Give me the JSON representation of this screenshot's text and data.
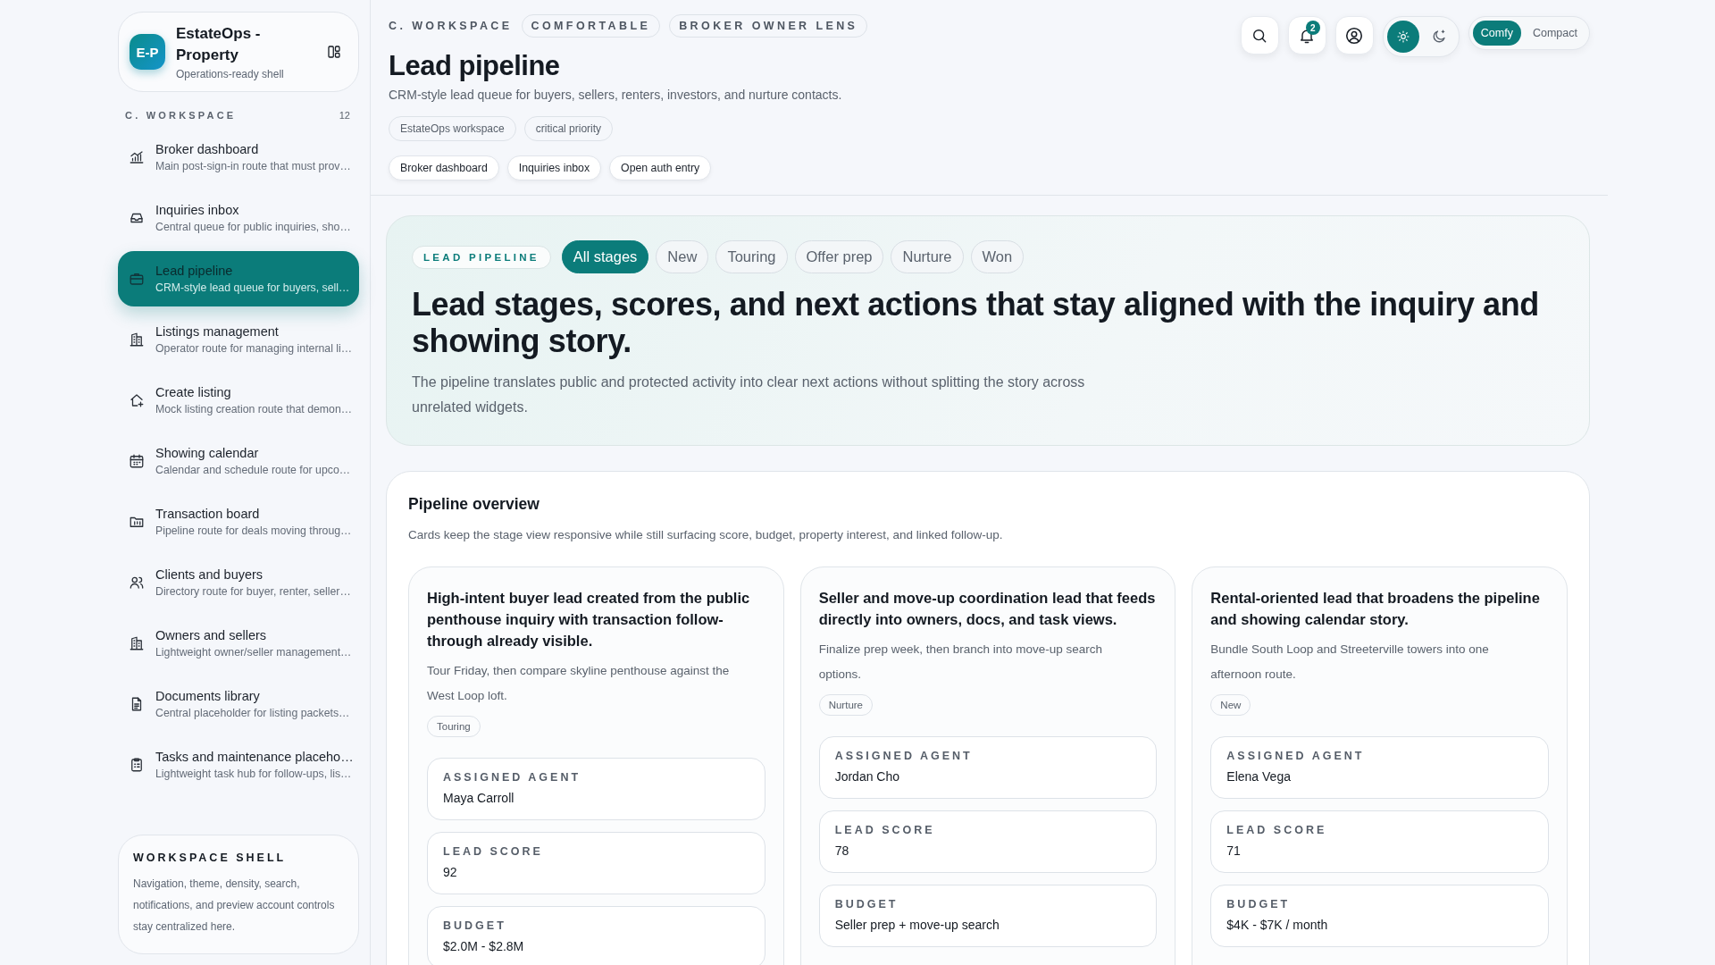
{
  "brand": {
    "initials": "E-P",
    "name": "EstateOps - Property",
    "subtitle": "Operations-ready shell"
  },
  "nav": {
    "section": "C. WORKSPACE",
    "count": "12",
    "items": [
      {
        "title": "Broker dashboard",
        "desc": "Main post-sign-in route that must prov…",
        "selected": false
      },
      {
        "title": "Inquiries inbox",
        "desc": "Central queue for public inquiries, sho…",
        "selected": false
      },
      {
        "title": "Lead pipeline",
        "desc": "CRM-style lead queue for buyers, sell…",
        "selected": true
      },
      {
        "title": "Listings management",
        "desc": "Operator route for managing internal li…",
        "selected": false
      },
      {
        "title": "Create listing",
        "desc": "Mock listing creation route that demon…",
        "selected": false
      },
      {
        "title": "Showing calendar",
        "desc": "Calendar and schedule route for upco…",
        "selected": false
      },
      {
        "title": "Transaction board",
        "desc": "Pipeline route for deals moving throug…",
        "selected": false
      },
      {
        "title": "Clients and buyers",
        "desc": "Directory route for buyer, renter, seller…",
        "selected": false
      },
      {
        "title": "Owners and sellers",
        "desc": "Lightweight owner/seller management…",
        "selected": false
      },
      {
        "title": "Documents library",
        "desc": "Central placeholder for listing packets…",
        "selected": false
      },
      {
        "title": "Tasks and maintenance placeho…",
        "desc": "Lightweight task hub for follow-ups, lis…",
        "selected": false
      }
    ]
  },
  "shell_card": {
    "title": "WORKSPACE SHELL",
    "text": "Navigation, theme, density, search, notifications, and preview account controls stay centralized here."
  },
  "header": {
    "eyebrow": "C. WORKSPACE",
    "pills": [
      "COMFORTABLE",
      "BROKER OWNER LENS"
    ],
    "title": "Lead pipeline",
    "subtitle": "CRM-style lead queue for buyers, sellers, renters, investors, and nurture contacts.",
    "tags": [
      "EstateOps workspace",
      "critical priority"
    ],
    "links": [
      "Broker dashboard",
      "Inquiries inbox",
      "Open auth entry"
    ]
  },
  "toolbar": {
    "notification_count": "2",
    "theme": [
      {
        "kind": "light",
        "selected": true
      },
      {
        "kind": "dark",
        "selected": false
      }
    ],
    "density": [
      {
        "label": "Comfy",
        "selected": true
      },
      {
        "label": "Compact",
        "selected": false
      }
    ]
  },
  "hero": {
    "badge": "LEAD PIPELINE",
    "filters": [
      {
        "label": "All stages",
        "selected": true
      },
      {
        "label": "New",
        "selected": false
      },
      {
        "label": "Touring",
        "selected": false
      },
      {
        "label": "Offer prep",
        "selected": false
      },
      {
        "label": "Nurture",
        "selected": false
      },
      {
        "label": "Won",
        "selected": false
      }
    ],
    "headline": "Lead stages, scores, and next actions that stay aligned with the inquiry and showing story.",
    "text": "The pipeline translates public and protected activity into clear next actions without splitting the story across unrelated widgets."
  },
  "overview": {
    "title": "Pipeline overview",
    "text": "Cards keep the stage view responsive while still surfacing score, budget, property interest, and linked follow-up.",
    "leads": [
      {
        "title": "High-intent buyer lead created from the public penthouse inquiry with transaction follow-through already visible.",
        "note": "Tour Friday, then compare skyline penthouse against the West Loop loft.",
        "stage": "Touring",
        "fields": [
          {
            "label": "ASSIGNED AGENT",
            "value": "Maya Carroll"
          },
          {
            "label": "LEAD SCORE",
            "value": "92"
          },
          {
            "label": "BUDGET",
            "value": "$2.0M - $2.8M"
          }
        ]
      },
      {
        "title": "Seller and move-up coordination lead that feeds directly into owners, docs, and task views.",
        "note": "Finalize prep week, then branch into move-up search options.",
        "stage": "Nurture",
        "fields": [
          {
            "label": "ASSIGNED AGENT",
            "value": "Jordan Cho"
          },
          {
            "label": "LEAD SCORE",
            "value": "78"
          },
          {
            "label": "BUDGET",
            "value": "Seller prep + move-up search"
          }
        ]
      },
      {
        "title": "Rental-oriented lead that broadens the pipeline and showing calendar story.",
        "note": "Bundle South Loop and Streeterville towers into one afternoon route.",
        "stage": "New",
        "fields": [
          {
            "label": "ASSIGNED AGENT",
            "value": "Elena Vega"
          },
          {
            "label": "LEAD SCORE",
            "value": "71"
          },
          {
            "label": "BUDGET",
            "value": "$4K - $7K / month"
          }
        ]
      }
    ]
  }
}
